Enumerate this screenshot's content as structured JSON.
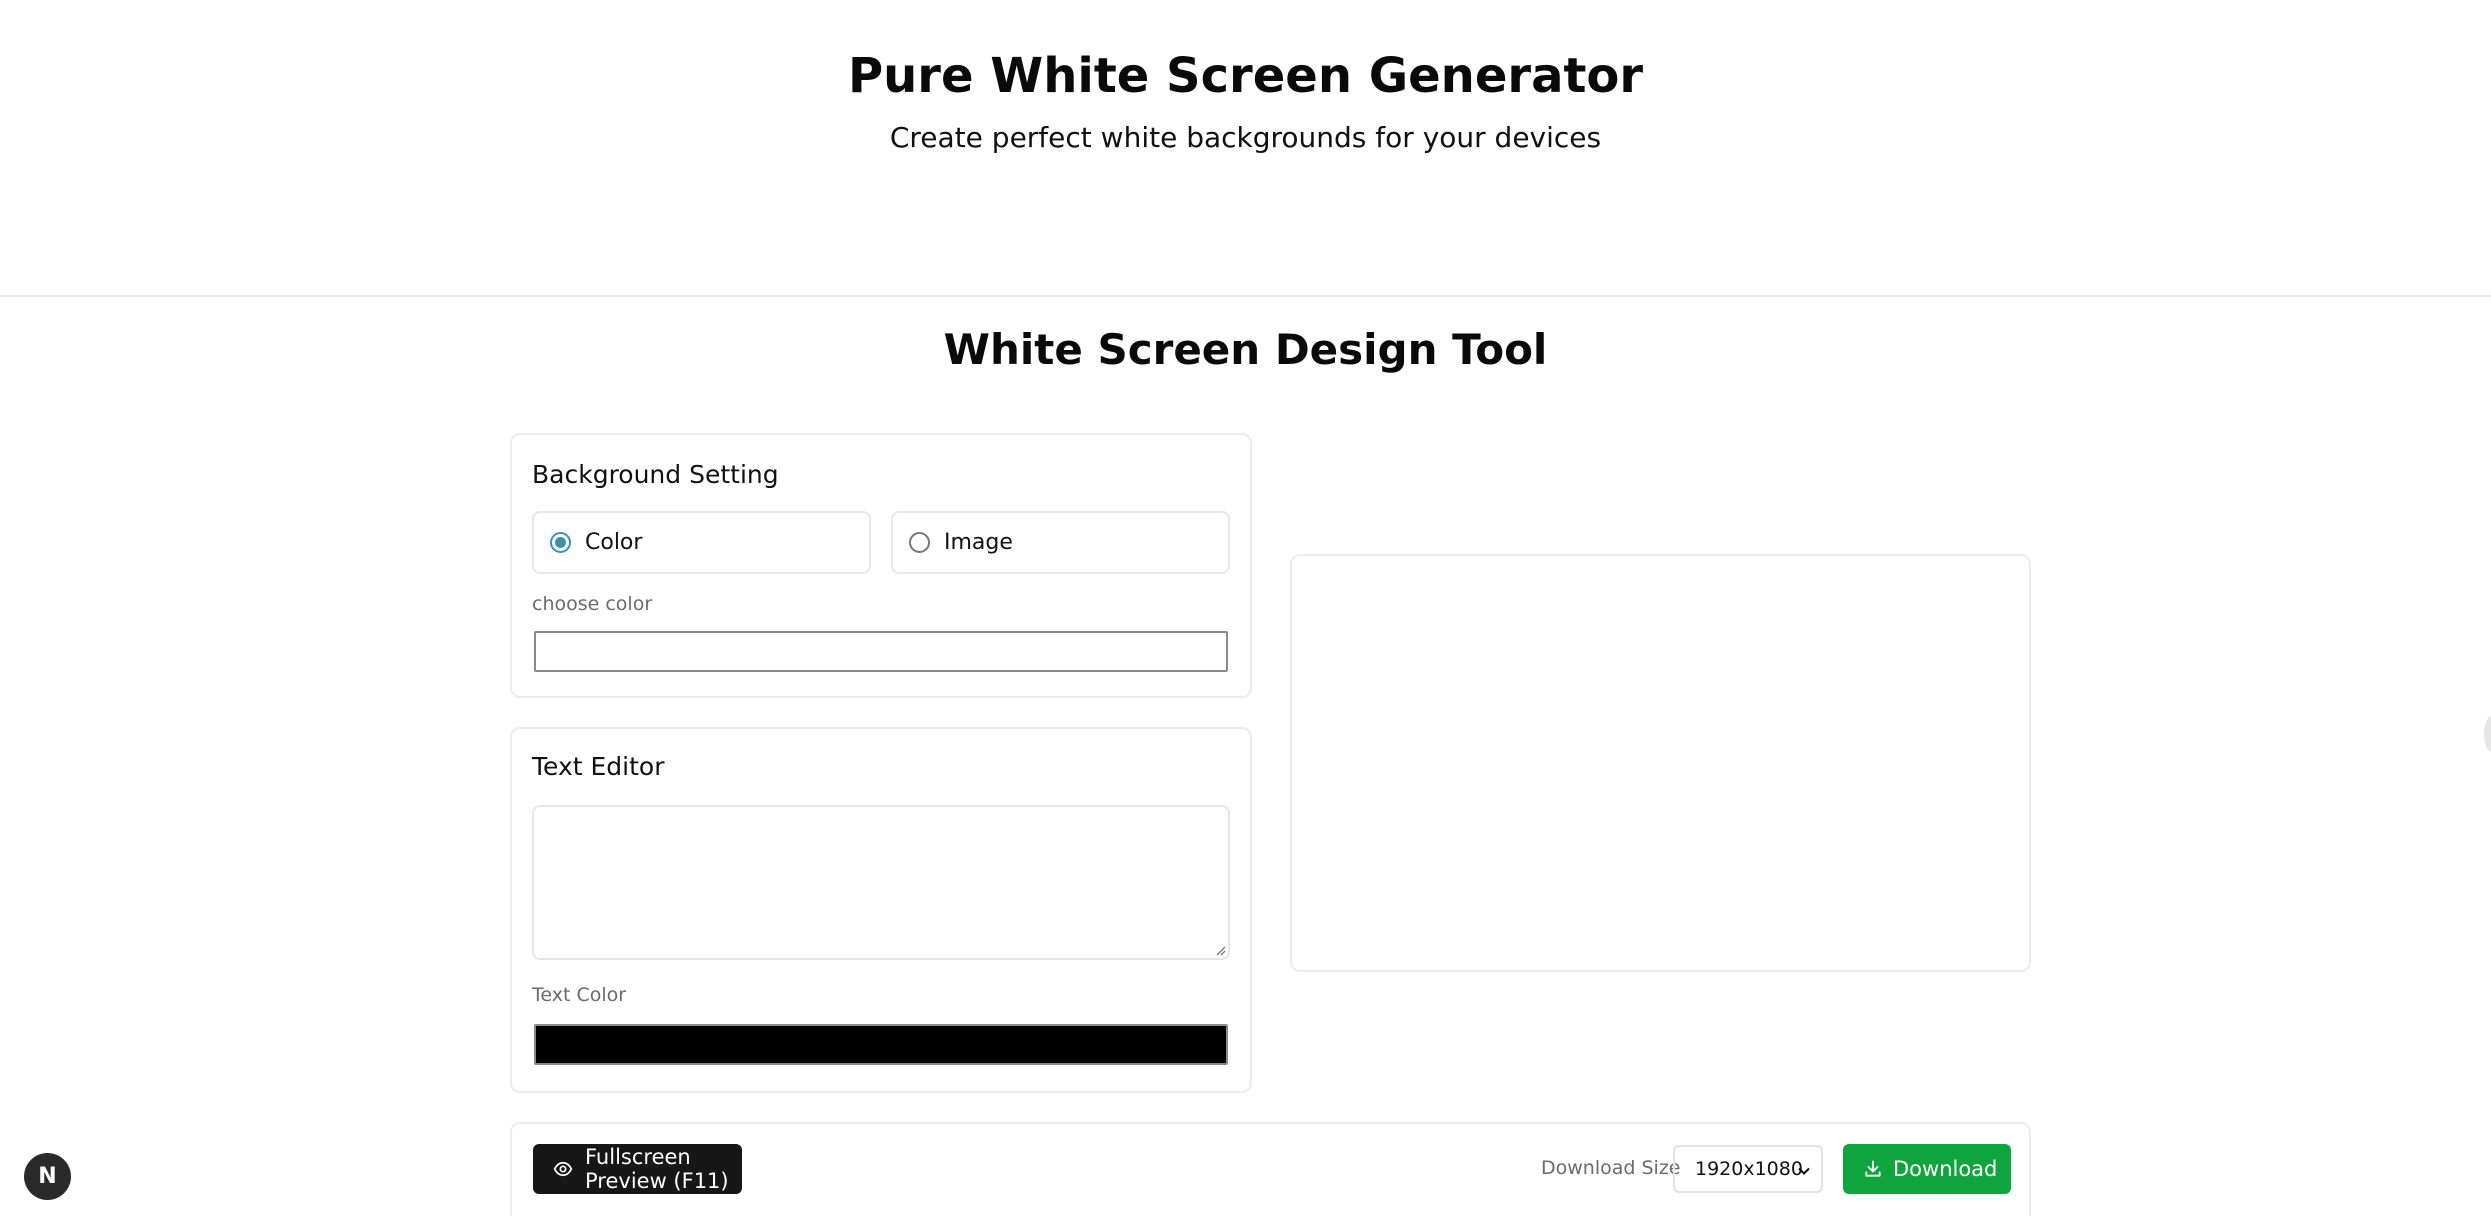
{
  "hero": {
    "title": "Pure White Screen Generator",
    "subtitle": "Create perfect white backgrounds for your devices"
  },
  "tool": {
    "title": "White Screen Design Tool"
  },
  "background_setting": {
    "title": "Background Setting",
    "options": [
      {
        "label": "Color",
        "checked": true
      },
      {
        "label": "Image",
        "checked": false
      }
    ],
    "choose_color_label": "choose color",
    "color_value": "#ffffff"
  },
  "text_editor": {
    "title": "Text Editor",
    "text_value": "",
    "text_color_label": "Text Color",
    "text_color_value": "#000000"
  },
  "preview": {
    "background_color": "#ffffff"
  },
  "actions": {
    "fullscreen_label": "Fullscreen Preview (F11)",
    "download_size_label": "Download Size",
    "download_size_value": "1920x1080",
    "download_label": "Download"
  },
  "badge": {
    "letter": "N"
  },
  "colors": {
    "download_button": "#10a43f",
    "preview_button": "#171717",
    "radio_accent": "#3d8fb0"
  }
}
